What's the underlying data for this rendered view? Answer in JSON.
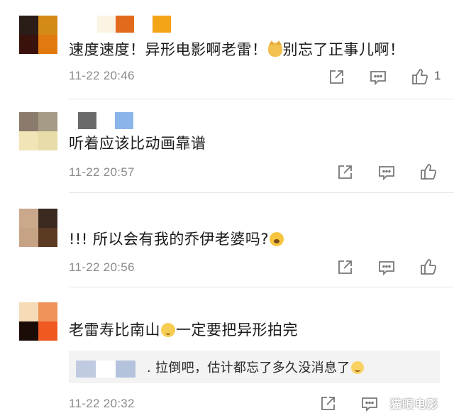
{
  "comments": [
    {
      "text_a": "速度速度！异形电影啊老雷！",
      "text_b": "别忘了正事儿啊！",
      "emoji": "cat-emoji",
      "time": "11-22 20:46",
      "likes": "1",
      "avatar_colors": [
        "#2a1c17",
        "#d48a16",
        "#3a120c",
        "#e07a10"
      ],
      "name_colors": [
        "#fbf4e4",
        "#e26a1c",
        "#ffffff",
        "#f4a417"
      ]
    },
    {
      "text": "听着应该比动画靠谱",
      "time": "11-22 20:57",
      "avatar_colors": [
        "#8a7b6c",
        "#a69b84",
        "#f1e4b6",
        "#e8dca8"
      ],
      "name_colors": [
        "#6a6a6a",
        "#ffffff",
        "#8ab4ea"
      ]
    },
    {
      "text": "!!! 所以会有我的乔伊老婆吗?",
      "emoji": "scared-emoji",
      "time": "11-22 20:56",
      "avatar_colors": [
        "#c9a88c",
        "#3b2a20",
        "#c7a385",
        "#5b3a22"
      ],
      "name_colors": []
    },
    {
      "text_a": "老雷寿比南山",
      "text_b": "一定要把异形拍完",
      "emoji": "pleading-emoji",
      "reply": ". 拉倒吧，估计都忘了多久没消息了",
      "reply_emoji": "smile-emoji",
      "time": "11-22 20:32",
      "avatar_colors": [
        "#f5dcb6",
        "#f0935a",
        "#1c0c08",
        "#f05a22"
      ],
      "name_colors": [],
      "reply_name_colors": [
        "#c0cbe2",
        "#ffffff",
        "#b4c2dc"
      ]
    }
  ],
  "watermark": "猫眼电影",
  "colors": {
    "timestamp": "#8a8a8a",
    "icon": "#777777",
    "reply_bg": "#f3f3f3"
  }
}
